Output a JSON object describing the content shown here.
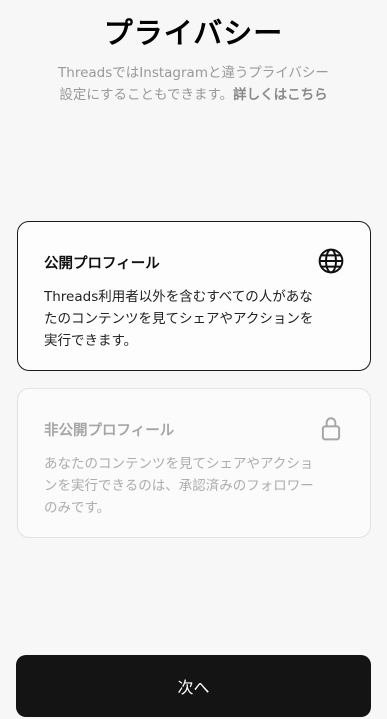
{
  "header": {
    "title": "プライバシー",
    "subtitle_line1": "ThreadsではInstagramと違うプライバシー",
    "subtitle_line2": "設定にすることもできます。",
    "learn_more": "詳しくはこちら"
  },
  "options": [
    {
      "title": "公開プロフィール",
      "description_line1": "Threads利用者以外を含むすべての人があな",
      "description_line2": "たのコンテンツを見てシェアやアクションを",
      "description_line3": "実行できます。",
      "icon": "globe-icon",
      "selected": true
    },
    {
      "title": "非公開プロフィール",
      "description_line1": "あなたのコンテンツを見てシェアやアクショ",
      "description_line2": "ンを実行できるのは、承認済みのフォロワー",
      "description_line3": "のみです。",
      "icon": "lock-icon",
      "selected": false
    }
  ],
  "footer": {
    "next_label": "次へ"
  },
  "colors": {
    "background": "#f7f7f7",
    "button": "#141414",
    "selected_border": "#1a1a1a",
    "muted_text": "#adadad"
  }
}
